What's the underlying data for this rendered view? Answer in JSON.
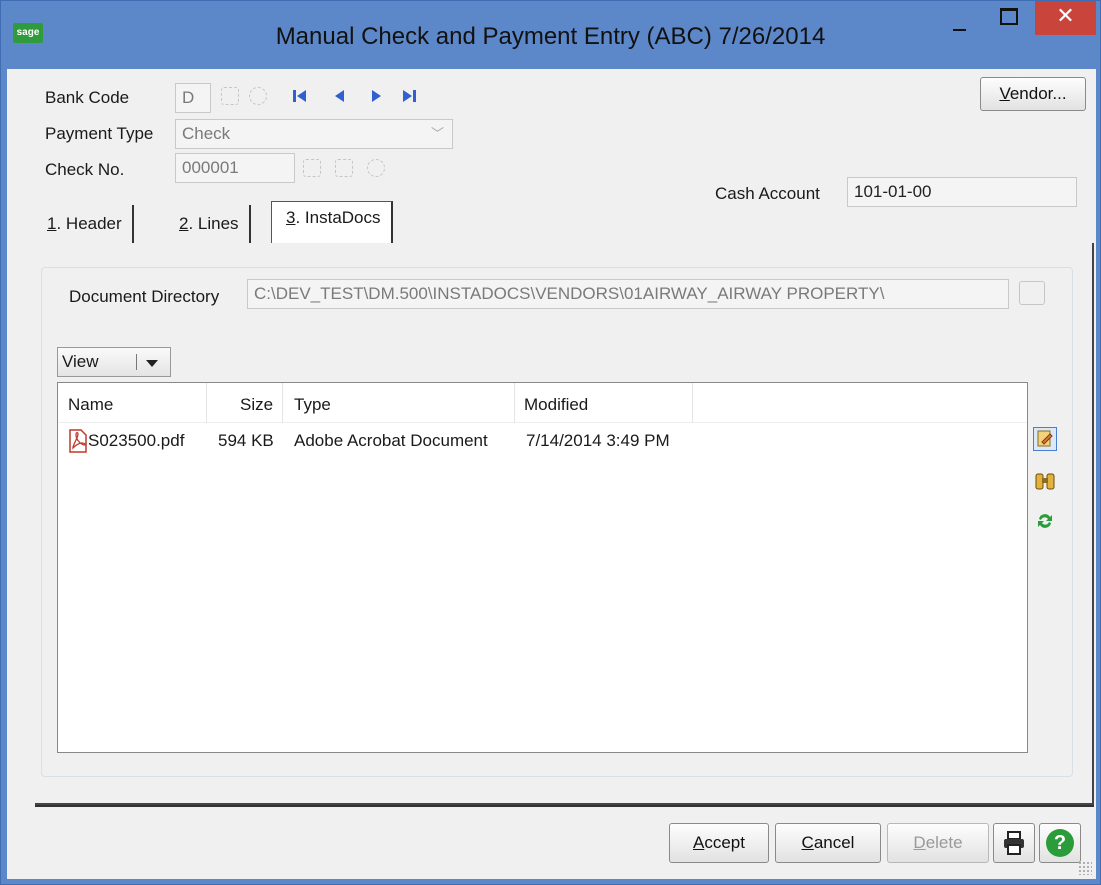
{
  "window": {
    "logo_text": "sage",
    "title": "Manual Check and Payment Entry (ABC) 7/26/2014",
    "close_glyph": "✕"
  },
  "form": {
    "bank_code_label": "Bank Code",
    "bank_code_value": "D",
    "payment_type_label": "Payment Type",
    "payment_type_value": "Check",
    "check_no_label": "Check No.",
    "check_no_value": "000001",
    "cash_account_label": "Cash Account",
    "cash_account_value": "101-01-00",
    "vendor_button": {
      "u": "V",
      "rest": "endor..."
    }
  },
  "tabs": [
    {
      "u": "1",
      "rest": ". Header"
    },
    {
      "u": "2",
      "rest": ". Lines"
    },
    {
      "u": "3",
      "rest": ". InstaDocs"
    }
  ],
  "instadocs": {
    "directory_label": "Document Directory",
    "directory_value": "C:\\DEV_TEST\\DM.500\\INSTADOCS\\VENDORS\\01AIRWAY_AIRWAY PROPERTY\\",
    "view_label": "View",
    "columns": [
      "Name",
      "Size",
      "Type",
      "Modified"
    ],
    "rows": [
      {
        "name": "S023500.pdf",
        "size": "594 KB",
        "type": "Adobe Acrobat Document",
        "modified": "7/14/2014 3:49 PM",
        "icon": "pdf-file-icon"
      }
    ],
    "side_icons": [
      "open-document-icon",
      "binoculars-icon",
      "refresh-icon"
    ]
  },
  "footer": {
    "accept": {
      "u": "A",
      "rest": "ccept"
    },
    "cancel": {
      "u": "C",
      "rest": "ancel"
    },
    "delete": {
      "u": "D",
      "rest": "elete"
    }
  },
  "colors": {
    "title_bar": "#5c87c8",
    "close_button": "#c9443a",
    "nav_arrows": "#2f5fd0",
    "help_button": "#2a9d3a"
  }
}
